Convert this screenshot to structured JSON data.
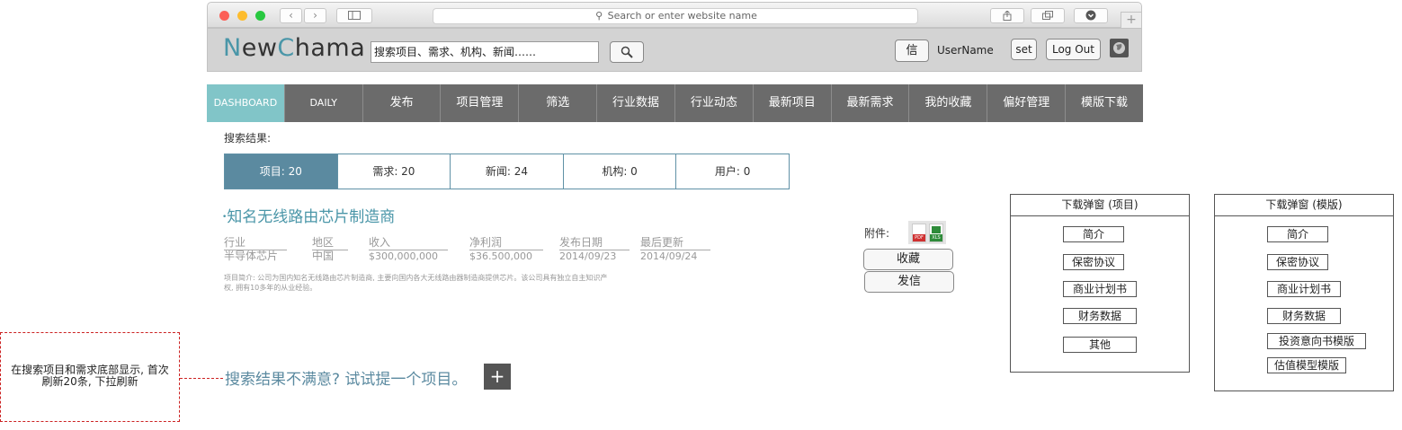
{
  "browser": {
    "address_placeholder": "Search or enter website name"
  },
  "header": {
    "logo": {
      "part1": "N",
      "part2": "ew",
      "part3": "C",
      "part4": "hama"
    },
    "search_value": "搜索项目、需求、机构、新闻……",
    "message_label": "信",
    "username": "UserName",
    "settings_label": "set",
    "logout_label": "Log Out"
  },
  "nav": {
    "items": [
      "DASHBOARD",
      "DAILY",
      "发布",
      "项目管理",
      "筛选",
      "行业数据",
      "行业动态",
      "最新项目",
      "最新需求",
      "我的收藏",
      "偏好管理",
      "模版下载"
    ]
  },
  "results": {
    "heading": "搜索结果:",
    "tabs": [
      "项目: 20",
      "需求: 20",
      "新闻: 24",
      "机构: 0",
      "用户: 0"
    ]
  },
  "project": {
    "title": "知名无线路由芯片制造商",
    "fields": [
      {
        "label": "行业",
        "value": "半导体芯片"
      },
      {
        "label": "地区",
        "value": "中国"
      },
      {
        "label": "收入",
        "value": "$300,000,000"
      },
      {
        "label": "净利润",
        "value": "$36.500,000"
      },
      {
        "label": "发布日期",
        "value": "2014/09/23"
      },
      {
        "label": "最后更新",
        "value": "2014/09/24"
      }
    ],
    "description_line1": "项目简介: 公司为国内知名无线路由芯片制造商, 主要向国内各大无线路由器制造商提供芯片。该公司具有独立自主知识产",
    "description_line2": "权, 拥有10多年的从业经验。",
    "attachments_label": "附件:",
    "pdf_label": "PDF",
    "xls_label": "XLS",
    "favorite_label": "收藏",
    "send_label": "发信"
  },
  "suggestion": {
    "text": "搜索结果不满意? 试试提一个项目。",
    "add_label": "+"
  },
  "annotation": {
    "line1": "在搜索项目和需求底部显示, 首次",
    "line2": "刷新20条, 下拉刷新"
  },
  "download_project": {
    "title": "下载弹窗 (项目)",
    "items": [
      "简介",
      "保密协议",
      "商业计划书",
      "财务数据",
      "其他"
    ]
  },
  "download_template": {
    "title": "下载弹窗 (模版)",
    "items": [
      "简介",
      "保密协议",
      "商业计划书",
      "财务数据",
      "投资意向书模版",
      "估值模型模版"
    ]
  },
  "colors": {
    "accent": "#4a96a8",
    "nav_bg": "#6b6b6b",
    "nav_active": "#81c5c8",
    "tab_active": "#5b8aa0",
    "annotation": "#cc2222"
  }
}
